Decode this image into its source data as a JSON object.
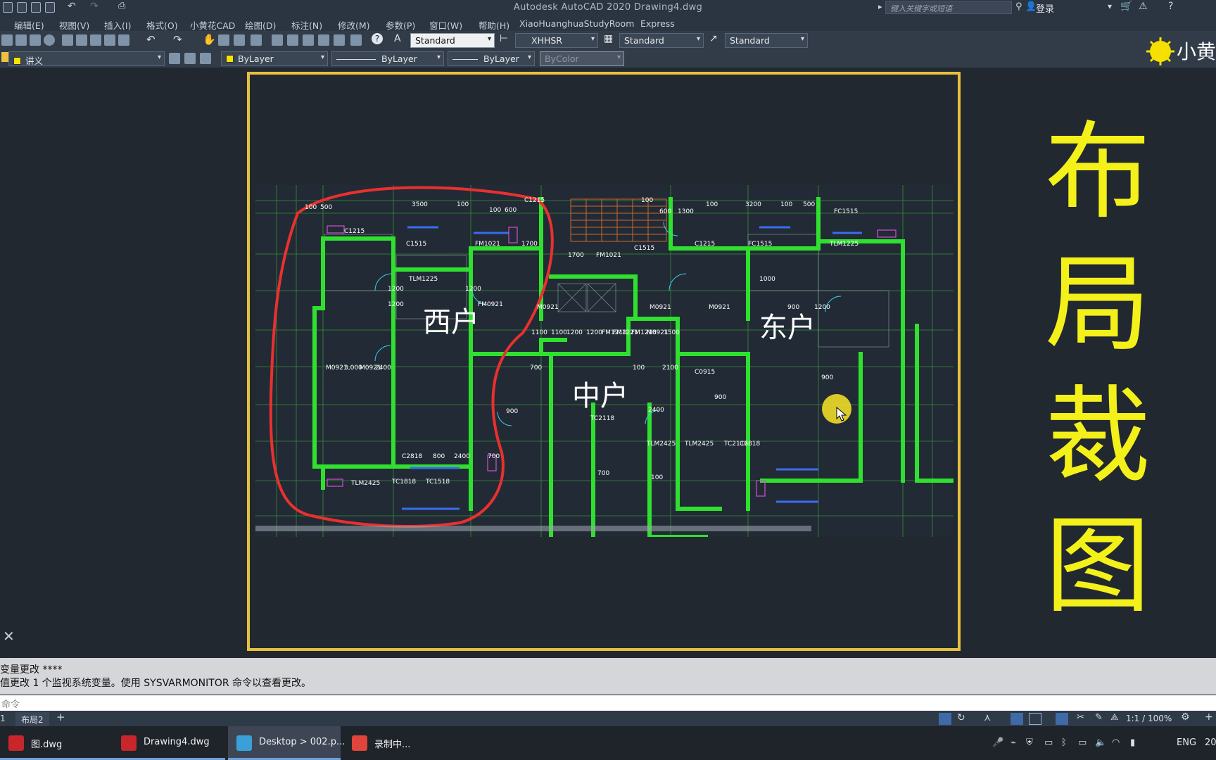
{
  "app": {
    "title": "Autodesk AutoCAD 2020    Drawing4.dwg",
    "search_placeholder": "键入关键字或短语",
    "login": "登录"
  },
  "menu": [
    "编辑(E)",
    "视图(V)",
    "插入(I)",
    "格式(O)",
    "小黄花CAD",
    "绘图(D)",
    "标注(N)",
    "修改(M)",
    "参数(P)",
    "窗口(W)",
    "帮助(H)",
    "XiaoHuanghuaStudyRoom",
    "Express"
  ],
  "toolbar_styles": {
    "text_style": "Standard",
    "dim_style": "XHHSR",
    "table_style": "Standard",
    "mleader_style": "Standard"
  },
  "properties": {
    "layer": "讲义",
    "color": "ByLayer",
    "linetype": "ByLayer",
    "lineweight": "ByLayer",
    "plotstyle": "ByColor"
  },
  "brand_text": "小黄",
  "overlay_title": [
    "布",
    "局",
    "裁",
    "图"
  ],
  "plan_labels": {
    "west": "西户",
    "middle": "中户",
    "east": "东户"
  },
  "dimensions": [
    "100",
    "500",
    "3500",
    "100",
    "100",
    "600",
    "C1215",
    "100",
    "600",
    "1300",
    "100",
    "3200",
    "100",
    "500",
    "FC1515",
    "C1215",
    "C1515",
    "FM1021",
    "1700",
    "1700",
    "FM1021",
    "C1515",
    "C1215",
    "FC1515",
    "TLM1225",
    "TLM1225",
    "1000",
    "1200",
    "1200",
    "1200",
    "FM0921",
    "M0921",
    "M0921",
    "M0921",
    "900",
    "1200",
    "1100",
    "1100",
    "1200",
    "1200",
    "FM1218",
    "FM1221",
    "FM1218",
    "M0921",
    "1500",
    "700",
    "100",
    "2100",
    "C0915",
    "M0921",
    "3,000",
    "M0921",
    "2400",
    "900",
    "900",
    "2400",
    "900",
    "TC2118",
    "TLM2425",
    "TLM2425",
    "TC2116",
    "C2818",
    "C2818",
    "800",
    "2400",
    "700",
    "TLM2425",
    "TC1818",
    "TC1518",
    "700",
    "100"
  ],
  "command_history": [
    "变量更改 ****",
    "值更改 1 个监视系统变量。使用 SYSVARMONITOR 命令以查看更改。"
  ],
  "command_prompt": "命令",
  "layout_tabs": [
    "1",
    "布局2"
  ],
  "add_tab": "+",
  "zoom": "1:1 / 100%",
  "taskbar": [
    {
      "label": "图.dwg",
      "color": "#c8262b"
    },
    {
      "label": "Drawing4.dwg",
      "color": "#c8262b"
    },
    {
      "label": "Desktop > 002.p...",
      "color": "#3aa0d8"
    },
    {
      "label": "录制中...",
      "color": "#e0443a"
    }
  ],
  "system_tray": {
    "language": "ENG",
    "clock_partial": "20"
  }
}
